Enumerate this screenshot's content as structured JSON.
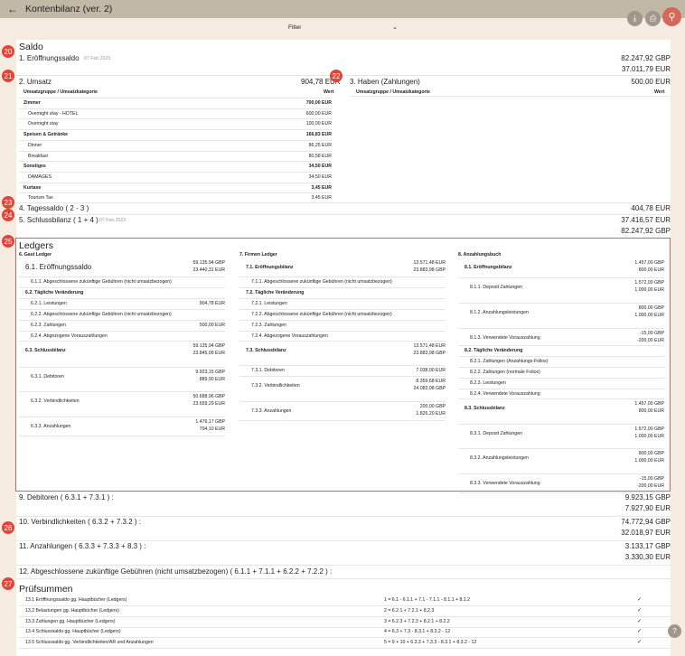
{
  "app": {
    "title": "Kontenbilanz (ver. 2)",
    "filter": "Filter"
  },
  "saldo": {
    "title": "Saldo",
    "eroeffnung": {
      "label": "1. Eröffnungssaldo",
      "date": "07 Feb 2023",
      "v1": "82.247,92 GBP",
      "v2": "37.011,79 EUR"
    },
    "umsatz": {
      "label": "2. Umsatz",
      "total": "904,78 EUR",
      "col1": "Umsatzgruppe / Umsatzkategorie",
      "col2": "Wert",
      "rows": [
        {
          "name": "Zimmer",
          "value": "700,00 EUR",
          "group": true
        },
        {
          "name": "Overnight stay - HOTEL",
          "value": "600,00 EUR",
          "group": false
        },
        {
          "name": "Overnight stay",
          "value": "100,00 EUR",
          "group": false
        },
        {
          "name": "Speisen & Getränke",
          "value": "166,83 EUR",
          "group": true
        },
        {
          "name": "Dinner",
          "value": "86,25 EUR",
          "group": false
        },
        {
          "name": "Breakfast",
          "value": "80,58 EUR",
          "group": false
        },
        {
          "name": "Sonstiges",
          "value": "34,50 EUR",
          "group": true
        },
        {
          "name": "DAMAGES",
          "value": "34,50 EUR",
          "group": false
        },
        {
          "name": "Kurtaxe",
          "value": "3,45 EUR",
          "group": true
        },
        {
          "name": "Tourism Tax",
          "value": "3,45 EUR",
          "group": false
        }
      ]
    },
    "haben": {
      "label": "3. Haben (Zahlungen)",
      "total": "500,00 EUR",
      "col1": "Umsatzgruppe / Umsatzkategorie",
      "col2": "Wert"
    },
    "tagessaldo": {
      "label": "4. Tagessaldo ( 2 - 3 )",
      "value": "404,78 EUR"
    },
    "schluss": {
      "label": "5. Schlussbilanz ( 1 + 4 )",
      "date": "07 Feb 2023",
      "v1": "37.416,57 EUR",
      "v2": "82.247,92 GBP"
    }
  },
  "ledgers": {
    "title": "Ledgers",
    "gast": {
      "title": "6. Gast Ledger",
      "rows": [
        {
          "label": "6.1. Eröffnungssaldo",
          "v1": "59.135,94 GBP",
          "v2": "23.440,31 EUR",
          "kind": "mid"
        },
        {
          "label": "6.1.1. Abgeschlossene zukünftige Gebühren (nicht umsatzbezogen)",
          "v1": "",
          "v2": "",
          "kind": "sub"
        },
        {
          "label": "6.2. Tägliche Veränderung",
          "v1": "",
          "v2": "",
          "kind": "head"
        },
        {
          "label": "6.2.1. Leistungen",
          "v1": "904,78 EUR",
          "v2": "",
          "kind": "sub"
        },
        {
          "label": "6.2.2. Abgeschlossene zukünftige Gebühren (nicht umsatzbezogen)",
          "v1": "",
          "v2": "",
          "kind": "sub"
        },
        {
          "label": "6.2.3. Zahlungen",
          "v1": "500,00 EUR",
          "v2": "",
          "kind": "sub"
        },
        {
          "label": "6.2.4. Abgezogene Vorauszahlungen",
          "v1": "",
          "v2": "",
          "kind": "sub"
        },
        {
          "label": "6.3. Schlussbilanz",
          "v1": "59.135,94 GBP",
          "v2": "23.845,09 EUR",
          "kind": "headv"
        },
        {
          "label": "6.3.1. Debitoren",
          "v1": "9.923,15 GBP",
          "v2": "889,90 EUR",
          "kind": "subv"
        },
        {
          "label": "6.3.2. Verbindlichkeiten",
          "v1": "50.688,96 GBP",
          "v2": "23.659,29 EUR",
          "kind": "subv"
        },
        {
          "label": "6.3.3. Anzahlungen",
          "v1": "1.476,17 GBP",
          "v2": "704,10 EUR",
          "kind": "subv"
        }
      ]
    },
    "firmen": {
      "title": "7. Firmen Ledger",
      "rows": [
        {
          "label": "7.1. Eröffnungsbilanz",
          "v1": "13.571,48 EUR",
          "v2": "23.883,98 GBP",
          "kind": "headv"
        },
        {
          "label": "7.1.1. Abgeschlossene zukünftige Gebühren (nicht umsatzbezogen)",
          "v1": "",
          "v2": "",
          "kind": "sub"
        },
        {
          "label": "7.2. Tägliche Veränderung",
          "v1": "",
          "v2": "",
          "kind": "head"
        },
        {
          "label": "7.2.1. Leistungen",
          "v1": "",
          "v2": "",
          "kind": "sub"
        },
        {
          "label": "7.2.2. Abgeschlossene zukünftige Gebühren (nicht umsatzbezogen)",
          "v1": "",
          "v2": "",
          "kind": "sub"
        },
        {
          "label": "7.2.3. Zahlungen",
          "v1": "",
          "v2": "",
          "kind": "sub"
        },
        {
          "label": "7.2.4. Abgezogene Vorauszahlungen",
          "v1": "",
          "v2": "",
          "kind": "sub"
        },
        {
          "label": "7.3. Schlussbilanz",
          "v1": "13.571,48 EUR",
          "v2": "23.883,98 GBP",
          "kind": "headv"
        },
        {
          "label": "7.3.1. Debitoren",
          "v1": "7.038,00 EUR",
          "v2": "",
          "kind": "sub"
        },
        {
          "label": "7.3.2. Verbindlichkeiten",
          "v1": "8.359,68 EUR",
          "v2": "24.083,98 GBP",
          "kind": "subv"
        },
        {
          "label": "7.3.3. Anzahlungen",
          "v1": "200,00 GBP",
          "v2": "1.826,20 EUR",
          "kind": "subv"
        }
      ]
    },
    "anzahl": {
      "title": "8. Anzahlungsbuch",
      "rows": [
        {
          "label": "8.1. Eröffnungsbilanz",
          "v1": "1.457,00 GBP",
          "v2": "800,00 EUR",
          "kind": "headv"
        },
        {
          "label": "8.1.1. Deposit Zahlungen",
          "v1": "1.572,00 GBP",
          "v2": "1.000,00 EUR",
          "kind": "subv"
        },
        {
          "label": "8.1.2. Anzahlungsleistungen",
          "v1": "800,00 GBP",
          "v2": "1.000,00 EUR",
          "kind": "subv"
        },
        {
          "label": "8.1.3. Verwendete Vorauszahlung",
          "v1": "-15,00 GBP",
          "v2": "-200,00 EUR",
          "kind": "subv"
        },
        {
          "label": "8.2. Tägliche Veränderung",
          "v1": "",
          "v2": "",
          "kind": "head"
        },
        {
          "label": "8.2.1. Zahlungen (Anzahlungs-Folios)",
          "v1": "",
          "v2": "",
          "kind": "sub"
        },
        {
          "label": "8.2.2. Zahlungen (normale Folios)",
          "v1": "",
          "v2": "",
          "kind": "sub"
        },
        {
          "label": "8.2.3. Leistungen",
          "v1": "",
          "v2": "",
          "kind": "sub"
        },
        {
          "label": "8.2.4. Verwendete Vorauszahlung",
          "v1": "",
          "v2": "",
          "kind": "sub"
        },
        {
          "label": "8.3. Schlussbilanz",
          "v1": "1.457,00 GBP",
          "v2": "800,00 EUR",
          "kind": "headv"
        },
        {
          "label": "8.3.1. Deposit Zahlungen",
          "v1": "1.572,00 GBP",
          "v2": "1.000,00 EUR",
          "kind": "subv"
        },
        {
          "label": "8.3.2. Anzahlungsleistungen",
          "v1": "800,00 GBP",
          "v2": "1.000,00 EUR",
          "kind": "subv"
        },
        {
          "label": "8.3.3. Verwendete Vorauszahlung",
          "v1": "-15,00 GBP",
          "v2": "-200,00 EUR",
          "kind": "subv"
        }
      ]
    }
  },
  "totals": [
    {
      "label": "9. Debitoren ( 6.3.1 + 7.3.1 ) :",
      "v1": "9.923,15 GBP",
      "v2": "7.927,90 EUR"
    },
    {
      "label": "10. Verbindlichkeiten ( 6.3.2 + 7.3.2 ) :",
      "v1": "74.772,94 GBP",
      "v2": "32.018,97 EUR"
    },
    {
      "label": "11. Anzahlungen ( 6.3.3 + 7.3.3 + 8.3 ) :",
      "v1": "3.133,17 GBP",
      "v2": "3.330,30 EUR"
    },
    {
      "label": "12. Abgeschlossene zukünftige Gebühren (nicht umsatzbezogen) ( 6.1.1 + 7.1.1 + 6.2.2 + 7.2.2 ) :",
      "v1": "",
      "v2": ""
    }
  ],
  "pruef": {
    "title": "Prüfsummen",
    "check": "✓",
    "rows": [
      {
        "label": "13.1 Eröffnungssaldo gg. Hauptbücher (Ledgers)",
        "formula": "1 = 6.1 - 6.1.1 + 7.1 - 7.1.1 - 8.1.1 + 8.1.2"
      },
      {
        "label": "13.2 Belastungen gg. Hauptbücher (Ledgers)",
        "formula": "2 = 6.2.1 + 7.2.1 + 8.2.3"
      },
      {
        "label": "13.3 Zahlungen gg. Hauptbücher (Ledgers)",
        "formula": "3 = 6.2.3 + 7.2.3 + 8.2.1 + 8.2.2"
      },
      {
        "label": "13.4 Schlusssaldo gg. Hauptbücher (Ledgers)",
        "formula": "4 = 6.3 + 7.3 - 8.3.1 + 8.3.2 - 12"
      },
      {
        "label": "13.5 Schlusssaldo gg. Verbindlichkeiten/AR und Anzahlungen",
        "formula": "5 = 9 + 10 + 6.3.3 + 7.3.3 - 8.3.1 + 8.3.2 - 12"
      }
    ]
  },
  "markers": [
    "20",
    "21",
    "22",
    "23",
    "24",
    "25",
    "26",
    "27"
  ],
  "colors": {
    "header": "#c2b8a8",
    "background": "#f6ebe0",
    "marker": "#e0453a",
    "ledger_border": "#e06060",
    "search_fab": "#d4695a"
  },
  "icons": {
    "back": "arrow-left-icon",
    "download": "download-icon",
    "print": "print-icon",
    "search": "search-icon",
    "help": "help-icon",
    "filter": "chevron-down-icon"
  }
}
